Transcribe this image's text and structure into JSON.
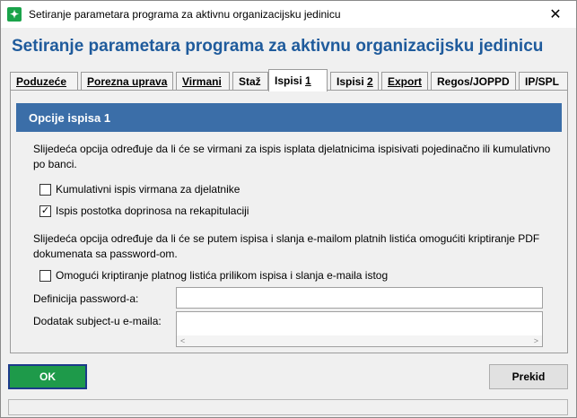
{
  "window": {
    "title": "Setiranje parametara programa za aktivnu organizacijsku jedinicu",
    "close_glyph": "✕",
    "app_icon": "green-star-icon"
  },
  "heading": "Setiranje parametara programa za aktivnu organizacijsku jedinicu",
  "tabs": [
    {
      "label": "Poduzeće"
    },
    {
      "label": "Porezna uprava"
    },
    {
      "label": "Virmani"
    },
    {
      "label": "Staž"
    },
    {
      "label_prefix": "Ispisi ",
      "label_u": "1",
      "active": true
    },
    {
      "label_prefix": "Ispisi ",
      "label_u": "2"
    },
    {
      "label": "Export"
    },
    {
      "label": "Regos/JOPPD"
    },
    {
      "label": "IP/SPL"
    }
  ],
  "section": {
    "title": "Opcije ispisa 1"
  },
  "paragraph1": "Slijedeća opcija određuje da li će se virmani za ispis isplata djelatnicima ispisivati pojedinačno ili kumulativno po banci.",
  "checks": {
    "kumulativni": {
      "label": "Kumulativni ispis virmana za djelatnike",
      "checked": false
    },
    "postotak": {
      "label": "Ispis postotka doprinosa na rekapitulaciji",
      "checked": true,
      "mark": "✓"
    },
    "kriptiranje": {
      "label": "Omogući kriptiranje platnog listića prilikom ispisa i slanja e-maila istog",
      "checked": false
    }
  },
  "paragraph2": "Slijedeća opcija određuje da li će se putem ispisa i slanja e-mailom platnih listića omogućiti kriptiranje PDF dokumenata sa password-om.",
  "fields": {
    "password": {
      "label": "Definicija password-a:",
      "value": ""
    },
    "subject": {
      "label": "Dodatak subject-u e-maila:",
      "value": ""
    }
  },
  "buttons": {
    "ok": "OK",
    "prekid": "Prekid"
  },
  "scroll": {
    "left": "<",
    "right": ">"
  }
}
